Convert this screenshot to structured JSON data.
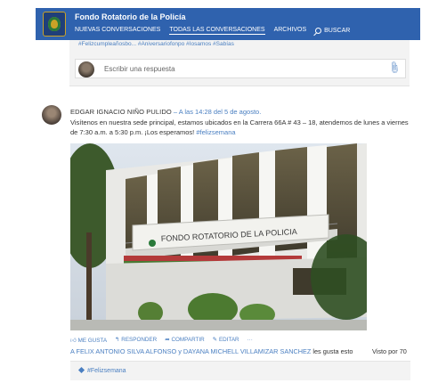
{
  "header": {
    "title": "Fondo Rotatorio de la Policía",
    "nav": [
      {
        "label": "NUEVAS CONVERSACIONES"
      },
      {
        "label": "TODAS LAS CONVERSACIONES"
      },
      {
        "label": "ARCHIVOS"
      },
      {
        "label": "BUSCAR"
      }
    ]
  },
  "previous_post": {
    "tags": "#Felizcumpleañosbo...   #Aniversariofonpo   #Iosamos   #Sabías",
    "reply_placeholder": "Escribir una respuesta"
  },
  "post": {
    "author": "EDGAR IGNACIO NIÑO PULIDO",
    "time": "– A las 14:28 del 5 de agosto.",
    "body": "Visítenos en nuestra sede principal, estamos ubicados en la Carrera 66A # 43 – 18, atendemos de lunes a viernes de 7:30 a.m. a 5:30 p.m. ¡Los esperamos!",
    "hashtag": "#felizsemana",
    "photo_sign": "FONDO ROTATORIO DE LA POLICIA",
    "actions": [
      "ME GUSTA",
      "RESPONDER",
      "COMPARTIR",
      "EDITAR",
      "···"
    ],
    "likes_names": "A FELIX ANTONIO SILVA ALFONSO y DAYANA MICHELL VILLAMIZAR SANCHEZ",
    "likes_rest": "les gusta esto",
    "seen": "Visto por 70",
    "tag": "#Felizsemana"
  },
  "colors": {
    "header_bg": "#2f62ae",
    "link": "#4a7fc1"
  }
}
